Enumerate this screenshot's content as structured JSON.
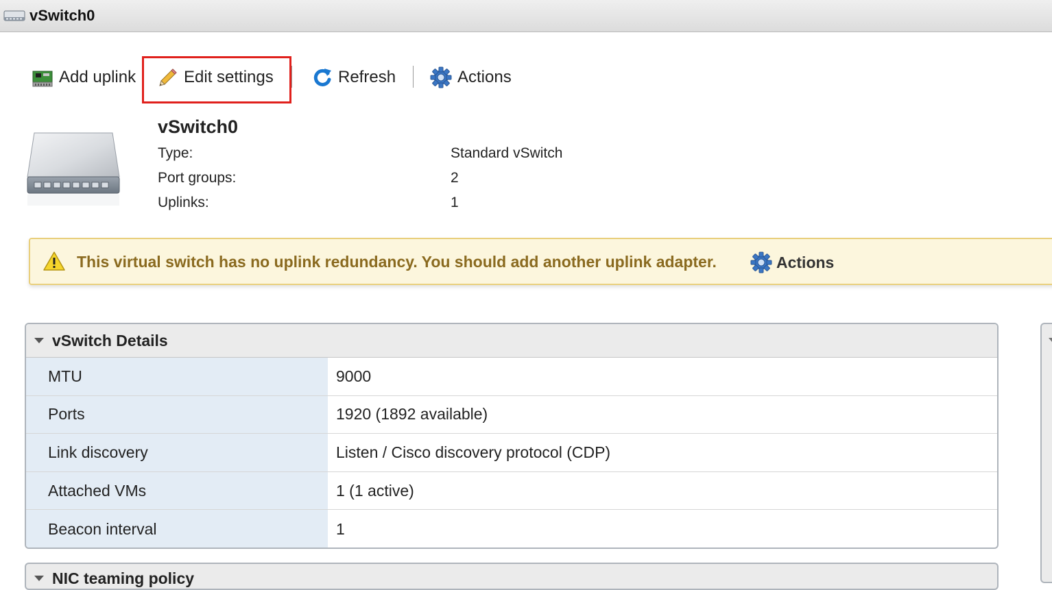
{
  "window": {
    "title": "vSwitch0",
    "icon": "network-switch-icon"
  },
  "toolbar": {
    "add_uplink": {
      "label": "Add uplink",
      "icon": "nic-card-icon"
    },
    "edit_settings": {
      "label": "Edit settings",
      "icon": "pencil-icon"
    },
    "refresh": {
      "label": "Refresh",
      "icon": "refresh-icon"
    },
    "actions": {
      "label": "Actions",
      "icon": "gear-icon"
    },
    "highlight_color": "#e0201c"
  },
  "summary": {
    "name": "vSwitch0",
    "rows": [
      {
        "label": "Type:",
        "value": "Standard vSwitch"
      },
      {
        "label": "Port groups:",
        "value": "2"
      },
      {
        "label": "Uplinks:",
        "value": "1"
      }
    ]
  },
  "warning": {
    "icon": "warning-triangle-icon",
    "text": "This virtual switch has no uplink redundancy. You should add another uplink adapter.",
    "action_label": "Actions",
    "background": "#fcf6dd",
    "text_color": "#8a6a1f"
  },
  "details": {
    "title": "vSwitch Details",
    "rows": [
      {
        "label": "MTU",
        "value": "9000"
      },
      {
        "label": "Ports",
        "value": "1920 (1892 available)"
      },
      {
        "label": "Link discovery",
        "value": "Listen / Cisco discovery protocol (CDP)"
      },
      {
        "label": "Attached VMs",
        "value": "1 (1 active)"
      },
      {
        "label": "Beacon interval",
        "value": "1"
      }
    ]
  },
  "nic_teaming": {
    "title": "NIC teaming policy"
  }
}
